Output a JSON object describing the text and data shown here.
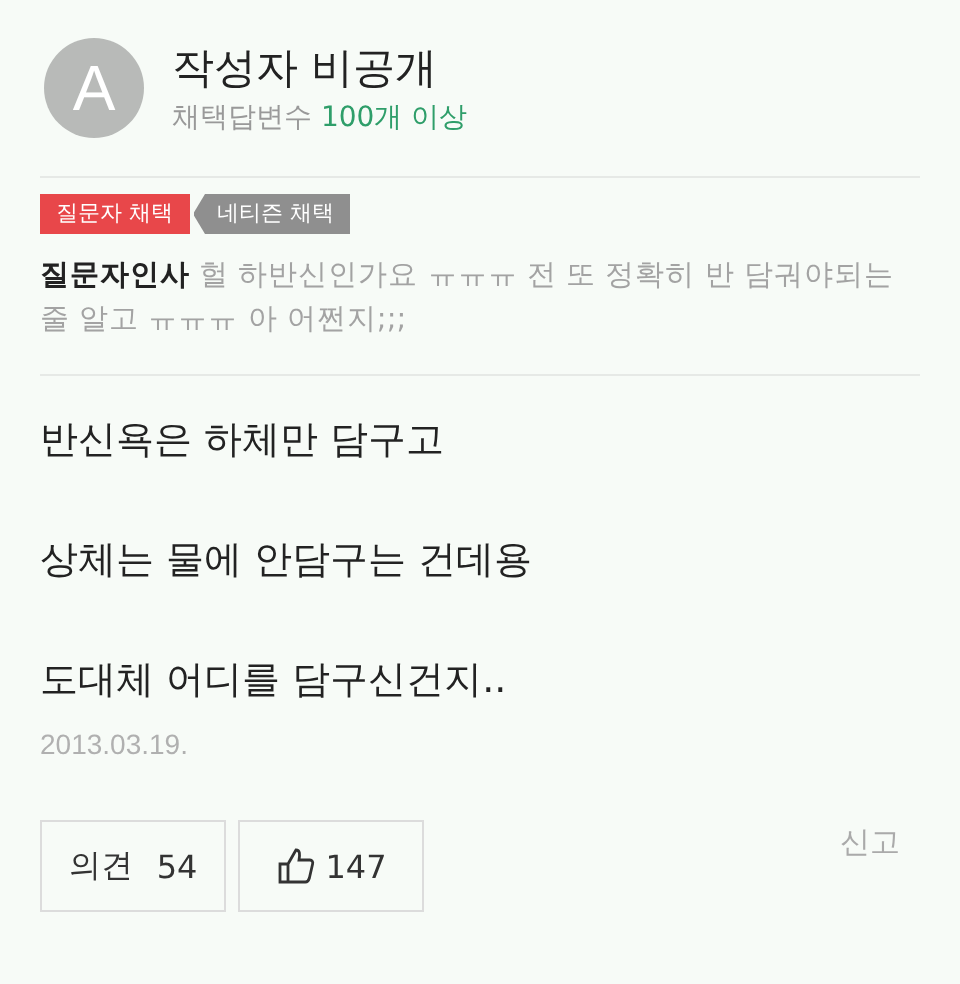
{
  "author": {
    "avatar_letter": "A",
    "name": "작성자 비공개",
    "stat_label": "채택답변수",
    "stat_value": "100개 이상"
  },
  "badges": [
    {
      "label": "질문자 채택",
      "color": "#e8474a"
    },
    {
      "label": "네티즌 채택",
      "color": "#8f8f8f"
    }
  ],
  "greeting": {
    "label": "질문자인사",
    "text": "헐 하반신인가요 ㅠㅠㅠ 전 또 정확히 반 담궈야되는 줄 알고 ㅠㅠㅠ 아 어쩐지;;;"
  },
  "body": [
    "반신욕은 하체만 담구고",
    "상체는 물에 안담구는 건데용",
    "도대체 어디를 담구신건지.."
  ],
  "date": "2013.03.19.",
  "actions": {
    "comments_label": "의견",
    "comments_count": "54",
    "likes": "147",
    "report": "신고"
  }
}
